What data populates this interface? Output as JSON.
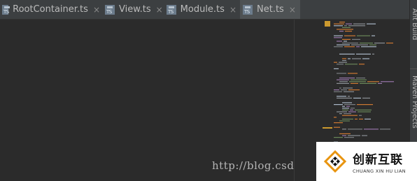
{
  "tabs": [
    {
      "label": "RootContainer.ts",
      "icon": "typescript-file-icon",
      "active": false
    },
    {
      "label": "View.ts",
      "icon": "typescript-file-icon",
      "active": false
    },
    {
      "label": "Module.ts",
      "icon": "typescript-file-icon",
      "active": false
    },
    {
      "label": "Net.ts",
      "icon": "typescript-file-icon",
      "active": true
    }
  ],
  "tab_icon_text": "TS",
  "close_glyph": "×",
  "right_panels": {
    "ant_build": "Ant Build",
    "maven_projects": "Maven Projects"
  },
  "watermark": "http://blog.csd",
  "logo": {
    "cn": "创新互联",
    "en": "CHUANG XIN HU LIAN"
  },
  "colors": {
    "editor_bg": "#2b2b2b",
    "tab_bg": "#3c3f41",
    "active_tab_bg": "#4e5254",
    "minimap_accent": "#cc9a2f"
  }
}
